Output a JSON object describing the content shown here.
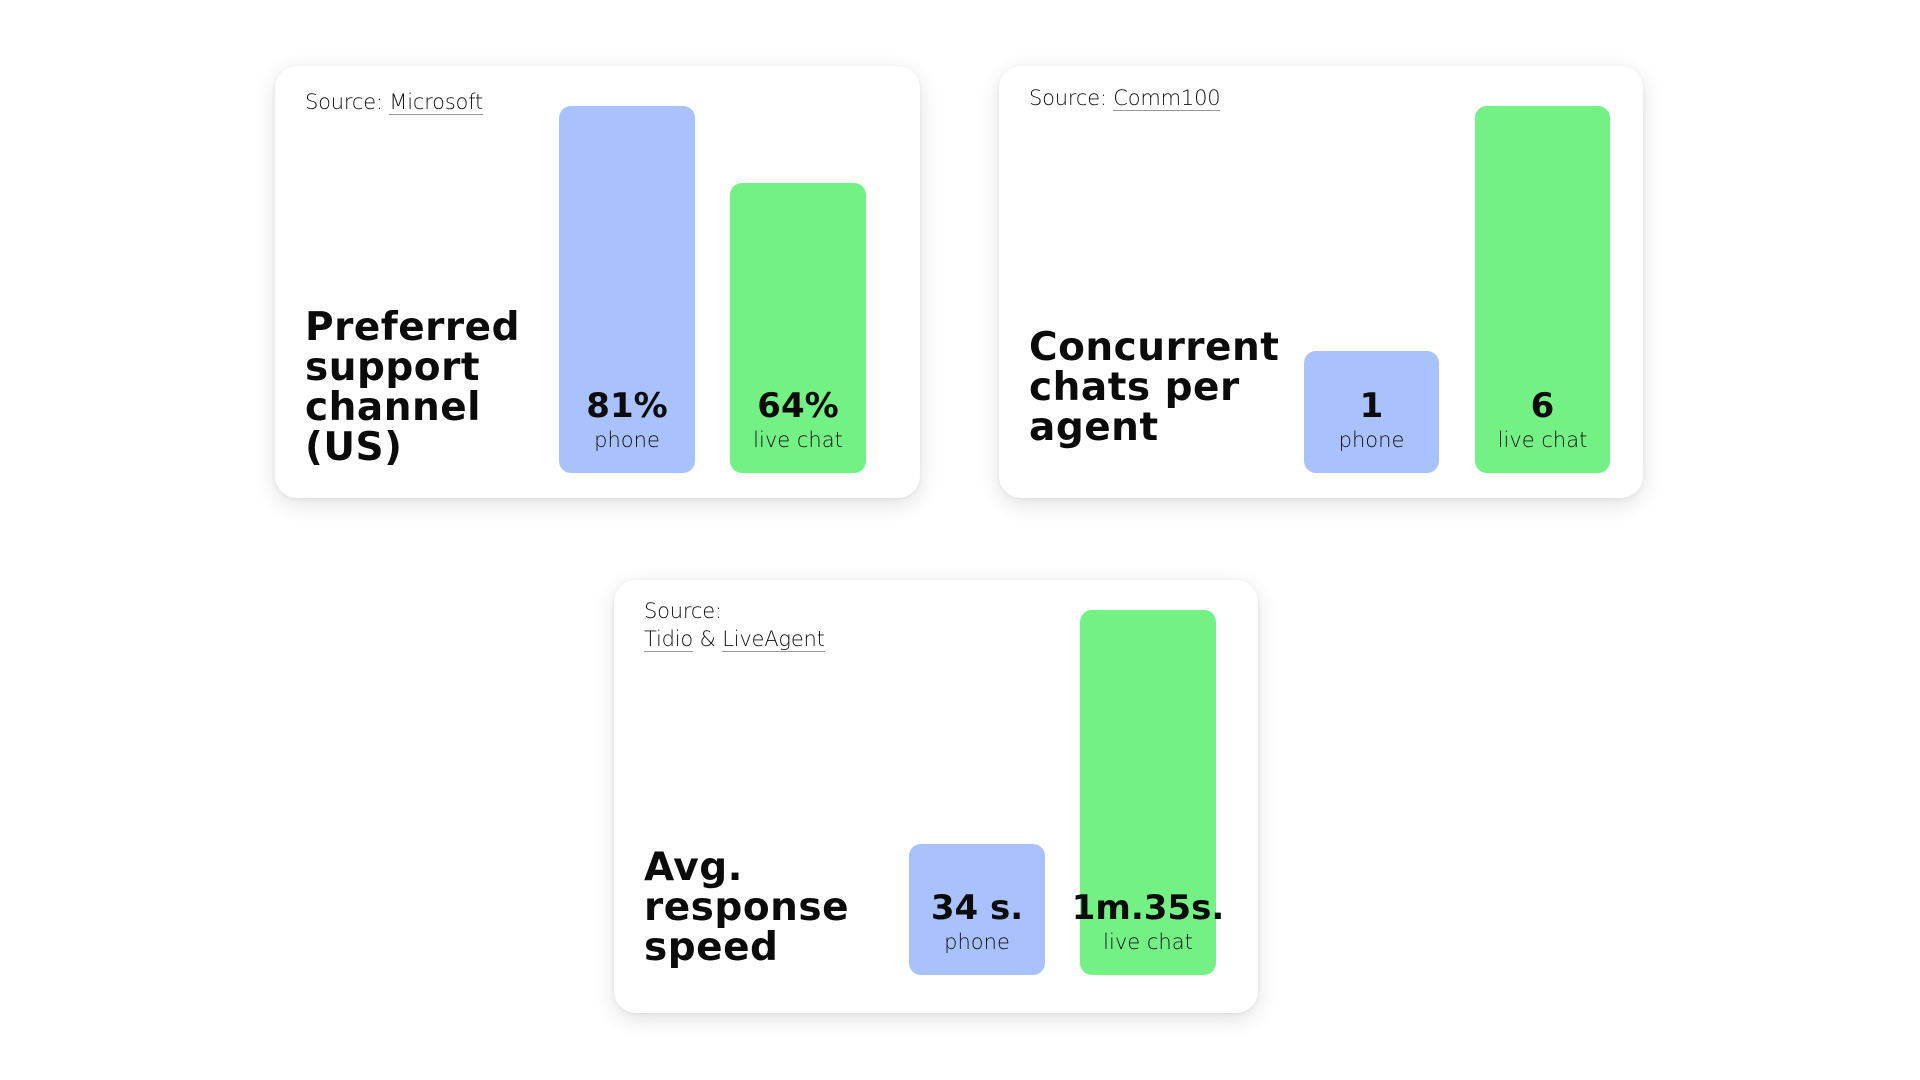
{
  "colors": {
    "phone": "#A9C2FD",
    "live_chat": "#73F184",
    "background": "#FFFFFF",
    "card": "#FFFFFF"
  },
  "cards": [
    {
      "source_prefix": "Source:",
      "sources": [
        {
          "label": "Microsoft"
        }
      ],
      "separator": "",
      "title": "Preferred support channel (US)"
    },
    {
      "source_prefix": "Source:",
      "sources": [
        {
          "label": "Comm100"
        }
      ],
      "separator": "",
      "title": "Concurrent chats per agent"
    },
    {
      "source_prefix": "Source:",
      "sources": [
        {
          "label": "Tidio"
        },
        {
          "label": "LiveAgent"
        }
      ],
      "separator": "&",
      "title": "Avg. response speed"
    }
  ],
  "chart_data": [
    {
      "type": "bar",
      "title": "Preferred support channel (US)",
      "source": "Microsoft",
      "categories": [
        "phone",
        "live chat"
      ],
      "values": [
        81,
        64
      ],
      "value_labels": [
        "81%",
        "64%"
      ],
      "unit": "%",
      "xlabel": "",
      "ylabel": "",
      "ylim": [
        0,
        81
      ],
      "grid": false,
      "legend": "none"
    },
    {
      "type": "bar",
      "title": "Concurrent chats per agent",
      "source": "Comm100",
      "categories": [
        "phone",
        "live chat"
      ],
      "values": [
        1,
        6
      ],
      "value_labels": [
        "1",
        "6"
      ],
      "unit": "chats",
      "xlabel": "",
      "ylabel": "",
      "ylim": [
        0,
        6
      ],
      "grid": false,
      "legend": "none"
    },
    {
      "type": "bar",
      "title": "Avg. response speed",
      "source": "Tidio & LiveAgent",
      "categories": [
        "phone",
        "live chat"
      ],
      "values": [
        34,
        95
      ],
      "value_labels": [
        "34 s.",
        "1m.35s."
      ],
      "unit": "seconds",
      "xlabel": "",
      "ylabel": "",
      "ylim": [
        0,
        95
      ],
      "grid": false,
      "legend": "none"
    }
  ]
}
